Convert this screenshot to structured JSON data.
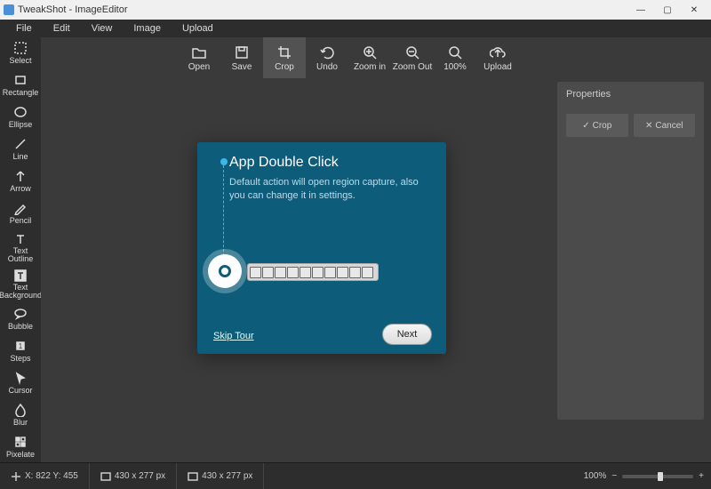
{
  "window": {
    "title": "TweakShot - ImageEditor"
  },
  "menubar": [
    "File",
    "Edit",
    "View",
    "Image",
    "Upload"
  ],
  "toolbar": [
    {
      "name": "open",
      "label": "Open"
    },
    {
      "name": "save",
      "label": "Save"
    },
    {
      "name": "crop",
      "label": "Crop",
      "active": true
    },
    {
      "name": "undo",
      "label": "Undo"
    },
    {
      "name": "zoomin",
      "label": "Zoom in"
    },
    {
      "name": "zoomout",
      "label": "Zoom Out"
    },
    {
      "name": "zoom100",
      "label": "100%"
    },
    {
      "name": "upload",
      "label": "Upload"
    }
  ],
  "sidebar": [
    {
      "name": "select",
      "label": "Select"
    },
    {
      "name": "rectangle",
      "label": "Rectangle"
    },
    {
      "name": "ellipse",
      "label": "Ellipse"
    },
    {
      "name": "line",
      "label": "Line"
    },
    {
      "name": "arrow",
      "label": "Arrow"
    },
    {
      "name": "pencil",
      "label": "Pencil"
    },
    {
      "name": "text-outline",
      "label": "Text\nOutline"
    },
    {
      "name": "text-background",
      "label": "Text\nBackground"
    },
    {
      "name": "bubble",
      "label": "Bubble"
    },
    {
      "name": "steps",
      "label": "Steps"
    },
    {
      "name": "cursor",
      "label": "Cursor"
    },
    {
      "name": "blur",
      "label": "Blur"
    },
    {
      "name": "pixelate",
      "label": "Pixelate"
    }
  ],
  "properties": {
    "title": "Properties",
    "crop": "Crop",
    "cancel": "Cancel"
  },
  "tour": {
    "title": "App Double Click",
    "body": "Default action will open region capture, also you can change it in settings.",
    "skip": "Skip Tour",
    "next": "Next"
  },
  "status": {
    "coords": "X: 822 Y: 455",
    "dim1": "430 x 277 px",
    "dim2": "430 x 277 px",
    "zoom": "100%"
  }
}
